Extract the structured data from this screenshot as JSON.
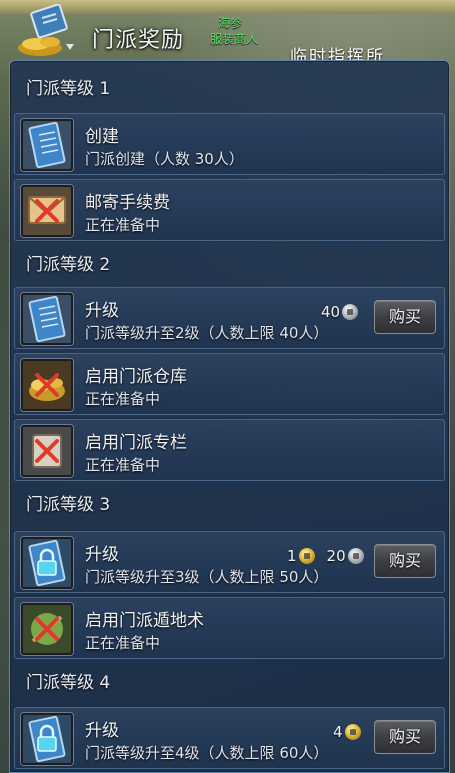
{
  "header": {
    "title": "门派奖励",
    "npc_name": "海参",
    "npc_role": "服装商人",
    "npc_sign": "临时指挥所"
  },
  "sections": [
    {
      "header": "门派等级 1",
      "rows": [
        {
          "title": "创建",
          "desc": "门派创建（人数 30人）",
          "icon": "scroll-icon"
        },
        {
          "title": "邮寄手续费",
          "desc": "正在准备中",
          "icon": "locked-x-icon"
        }
      ]
    },
    {
      "header": "门派等级 2",
      "rows": [
        {
          "title": "升级",
          "desc": "门派等级升至2级（人数上限 40人）",
          "icon": "scroll-icon",
          "price_silver": "40",
          "buy": "购买"
        },
        {
          "title": "启用门派仓库",
          "desc": "正在准备中",
          "icon": "locked-x-icon"
        },
        {
          "title": "启用门派专栏",
          "desc": "正在准备中",
          "icon": "locked-x-icon"
        }
      ]
    },
    {
      "header": "门派等级 3",
      "rows": [
        {
          "title": "升级",
          "desc": "门派等级升至3级（人数上限 50人）",
          "icon": "lock-scroll-icon",
          "price_gold": "1",
          "price_silver": "20",
          "buy": "购买"
        },
        {
          "title": "启用门派遁地术",
          "desc": "正在准备中",
          "icon": "locked-x-icon"
        }
      ]
    },
    {
      "header": "门派等级 4",
      "rows": [
        {
          "title": "升级",
          "desc": "门派等级升至4级（人数上限 60人）",
          "icon": "lock-scroll-icon",
          "price_gold": "4",
          "buy": "购买"
        }
      ]
    }
  ],
  "colors": {
    "panel_bg": "#223652",
    "npc_green": "#5fe06a",
    "button_bg": "#3d3f43"
  }
}
